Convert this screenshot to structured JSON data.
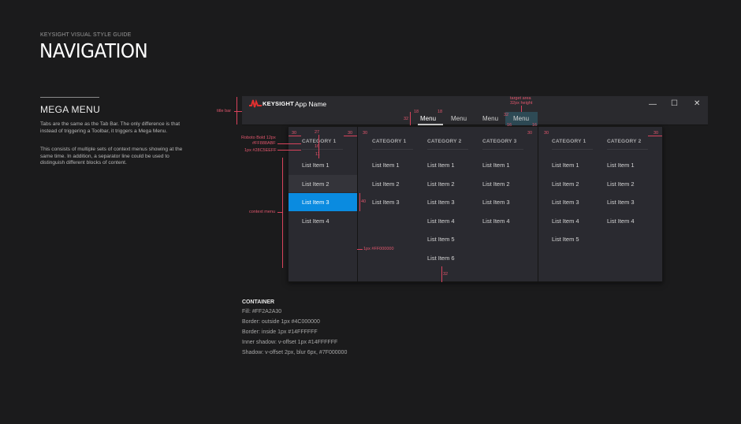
{
  "guide": {
    "label": "KEYSIGHT VISUAL STYLE GUIDE",
    "title": "NAVIGATION",
    "section_title": "MEGA MENU",
    "description": [
      "Tabs are the same as the Tab Bar. The only difference is that instead of triggering a Toolbar, it triggers a Mega Menu.",
      "This consists of multiple sets of context menus showing at the same time. In addition, a separator line could be used to distinguish different blocks of content."
    ]
  },
  "window": {
    "brand": "KEYSIGHT",
    "app_name": "App Name",
    "minimize": "—",
    "maximize": "☐",
    "close": "✕",
    "tabs": [
      "Menu",
      "Menu",
      "Menu",
      "Menu"
    ]
  },
  "mega_menu": {
    "columns": [
      {
        "category": "CATEGORY 1",
        "items": [
          "List Item 1",
          "List Item 2",
          "List Item 3",
          "List Item 4"
        ]
      },
      {
        "category": "CATEGORY 1",
        "items": [
          "List Item 1",
          "List Item 2",
          "List Item 3"
        ]
      },
      {
        "category": "CATEGORY 2",
        "items": [
          "List Item 1",
          "List Item 2",
          "List Item 3",
          "List Item 4",
          "List Item 5",
          "List Item 6"
        ]
      },
      {
        "category": "CATEGORY 3",
        "items": [
          "List Item 1",
          "List Item 2",
          "List Item 3",
          "List Item 4"
        ]
      },
      {
        "category": "CATEGORY 1",
        "items": [
          "List Item 1",
          "List Item 2",
          "List Item 3",
          "List Item 4",
          "List Item 5"
        ]
      },
      {
        "category": "CATEGORY 2",
        "items": [
          "List Item 1",
          "List Item 2",
          "List Item 3",
          "List Item 4"
        ]
      }
    ],
    "hover_item": "List Item 2",
    "selected_item": "List Item 3",
    "selected_color": "#0A8BE0"
  },
  "annotations": {
    "title_bar": "title bar",
    "font_spec": "Roboto Bold 12px",
    "font_color": "#FF888ABF",
    "line_spec": "1px #28C5EEFF",
    "context_menu": "context menu",
    "separator": "1px #FF000000",
    "target_area": "target area",
    "target_height": "32px height",
    "n30": "30",
    "n27": "27",
    "n16": "16",
    "n11": "11",
    "n40": "40",
    "n18": "18",
    "n32": "32"
  },
  "container": {
    "title": "CONTAINER",
    "lines": [
      "Fill: #FF2A2A30",
      "Border: outside 1px #4C000000",
      "Border: inside 1px #14FFFFFF",
      "Inner shadow: v-offset 1px #14FFFFFF",
      "Shadow: v-offset 2px, blur 6px, #7F000000"
    ]
  }
}
